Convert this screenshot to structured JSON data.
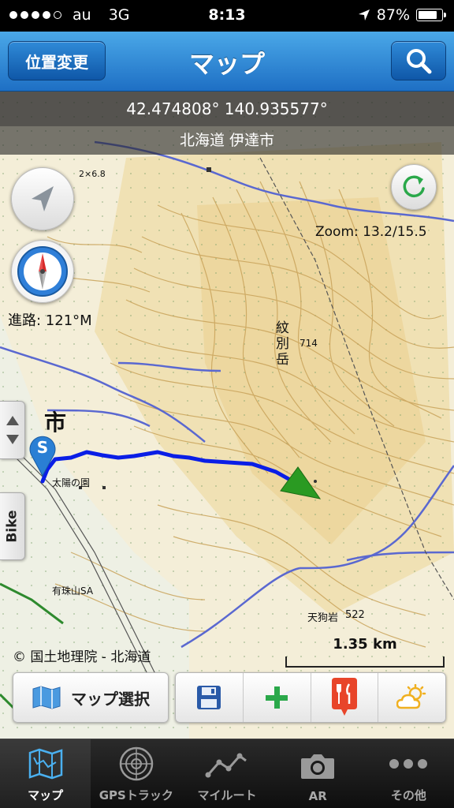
{
  "status_bar": {
    "carrier": "au",
    "network": "3G",
    "time": "8:13",
    "battery_text": "87%",
    "battery_level": 0.87
  },
  "nav": {
    "title": "マップ",
    "left_button": "位置変更",
    "right_icon": "search-icon"
  },
  "map": {
    "coordinates": "42.474808° 140.935577°",
    "place": "北海道 伊達市",
    "zoom": "Zoom: 13.2/15.5",
    "heading": "進路: 121°M",
    "side_tab": "Bike",
    "copyright": "© 国土地理院 - 北海道",
    "scale": "1.35 km",
    "start_marker": "S",
    "labels": {
      "city": "市",
      "mountain": "紋別岳",
      "elev1": "714",
      "elev2": "522",
      "peak": "天狗岩",
      "poi": "太陽の園",
      "sa": "有珠山SA",
      "mark": "2×6.8"
    }
  },
  "toolbar": {
    "map_select_label": "マップ選択",
    "icons": [
      "map-icon",
      "save-icon",
      "add-icon",
      "restaurant-icon",
      "weather-icon"
    ]
  },
  "tabs": [
    {
      "label": "マップ",
      "icon": "map-icon",
      "active": true
    },
    {
      "label": "GPSトラック",
      "icon": "radar-icon",
      "active": false
    },
    {
      "label": "マイルート",
      "icon": "route-icon",
      "active": false
    },
    {
      "label": "AR",
      "icon": "camera-icon",
      "active": false
    },
    {
      "label": "その他",
      "icon": "more-icon",
      "active": false
    }
  ],
  "colors": {
    "nav_blue": "#1e6fc4",
    "track_blue": "#0a1ee6",
    "arrow_green": "#2a9a22",
    "marker_blue": "#2a7fd4"
  }
}
